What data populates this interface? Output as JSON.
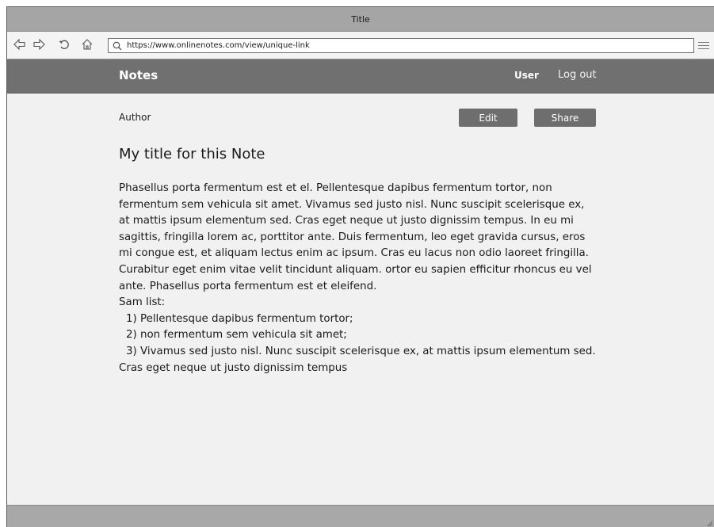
{
  "window": {
    "title": "Title"
  },
  "browser": {
    "url": "https://www.onlinenotes.com/view/unique-link",
    "icons": [
      "back-icon",
      "forward-icon",
      "refresh-icon",
      "home-icon",
      "search-icon",
      "menu-icon"
    ]
  },
  "header": {
    "brand": "Notes",
    "user": "User",
    "logout": "Log out"
  },
  "note": {
    "author": "Author",
    "edit_label": "Edit",
    "share_label": "Share",
    "title": "My title for this Note",
    "paragraph": "Phasellus porta fermentum est et el. Pellentesque dapibus fermentum tortor, non fermentum sem vehicula sit amet. Vivamus sed justo nisl. Nunc suscipit scelerisque ex, at mattis ipsum elementum sed. Cras eget neque ut justo dignissim tempus. In eu mi sagittis, fringilla lorem ac, porttitor ante. Duis fermentum, leo eget gravida cursus, eros mi congue est, et aliquam lectus enim ac ipsum. Cras eu lacus non odio laoreet fringilla. Curabitur eget enim vitae velit tincidunt aliquam. ortor eu sapien efficitur rhoncus eu vel ante. Phasellus porta fermentum est et eleifend.",
    "list_title": "Sam list:",
    "list": [
      "1) Pellentesque dapibus fermentum tortor;",
      "2) non fermentum sem vehicula sit amet;",
      "3) Vivamus sed justo nisl. Nunc suscipit scelerisque ex, at mattis ipsum elementum sed. Cras eget neque ut justo dignissim tempus"
    ]
  }
}
